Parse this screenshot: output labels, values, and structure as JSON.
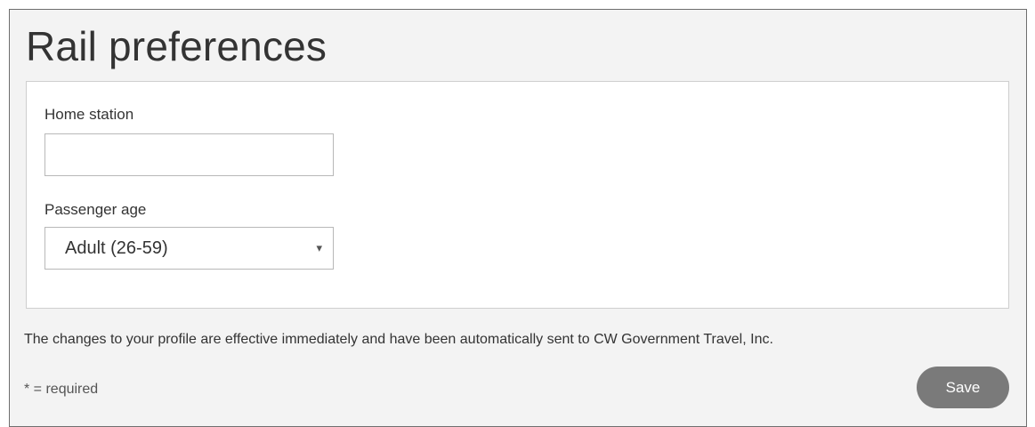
{
  "page": {
    "title": "Rail preferences"
  },
  "form": {
    "home_station": {
      "label": "Home station",
      "value": "",
      "placeholder": ""
    },
    "passenger_age": {
      "label": "Passenger age",
      "selected": "Adult (26-59)",
      "chevron": "▾"
    }
  },
  "footer": {
    "notice": "The changes to your profile are effective immediately and have been automatically sent to CW Government Travel, Inc.",
    "required_note": "* = required",
    "save_label": "Save"
  },
  "colors": {
    "panel_background": "#f3f3f3",
    "save_button": "#7a7a7a",
    "text": "#333333"
  }
}
